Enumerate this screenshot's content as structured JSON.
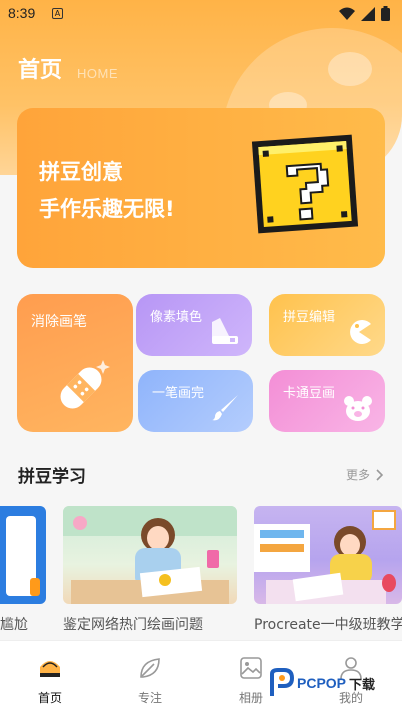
{
  "status_bar": {
    "time": "8:39",
    "notification_icon": "A"
  },
  "header": {
    "title": "首页",
    "subtitle": "HOME"
  },
  "banner": {
    "line1": "拼豆创意",
    "line2": "手作乐趣无限!"
  },
  "features": {
    "erase": "消除画笔",
    "pixel_fill": "像素填色",
    "bead_edit": "拼豆编辑",
    "one_stroke": "一笔画完",
    "cartoon": "卡通豆画"
  },
  "learning": {
    "title": "拼豆学习",
    "more": "更多",
    "cards": [
      {
        "caption": "尴尬"
      },
      {
        "caption": "鉴定网络热门绘画问题"
      },
      {
        "caption": "Procreate一中级班教学"
      }
    ]
  },
  "tabbar": {
    "items": [
      {
        "label": "首页",
        "icon": "home-icon",
        "active": true
      },
      {
        "label": "专注",
        "icon": "leaf-icon",
        "active": false
      },
      {
        "label": "相册",
        "icon": "album-icon",
        "active": false
      },
      {
        "label": "我的",
        "icon": "user-icon",
        "active": false
      }
    ]
  },
  "watermark": {
    "text": "PCPOP",
    "suffix": "下载"
  },
  "colors": {
    "accent": "#ffa43a",
    "purple": "#b796f5",
    "blue": "#8fb4fb",
    "pink": "#f38ed6",
    "yellow": "#ffc24d"
  }
}
